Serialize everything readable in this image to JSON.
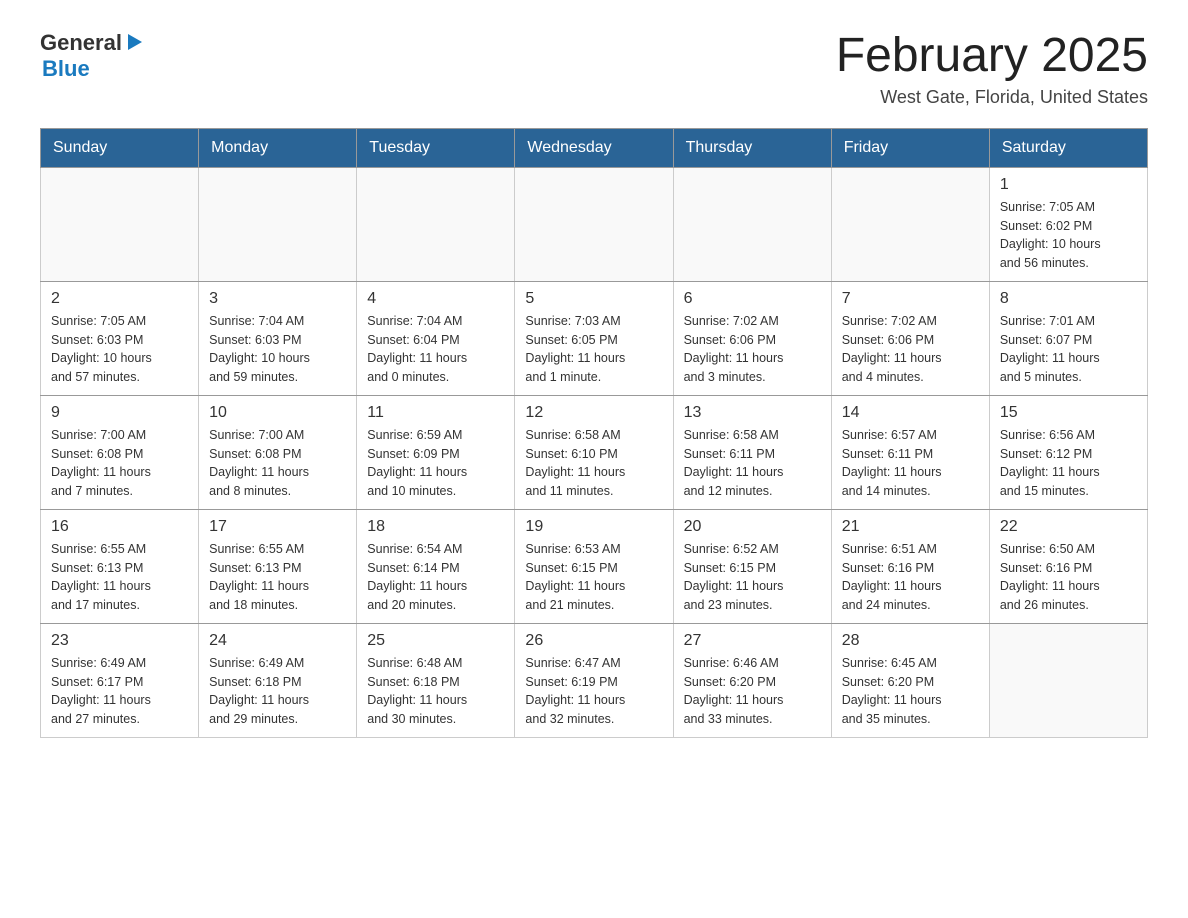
{
  "logo": {
    "general": "General",
    "blue": "Blue",
    "arrow": "▶"
  },
  "title": "February 2025",
  "subtitle": "West Gate, Florida, United States",
  "days_of_week": [
    "Sunday",
    "Monday",
    "Tuesday",
    "Wednesday",
    "Thursday",
    "Friday",
    "Saturday"
  ],
  "weeks": [
    [
      {
        "day": "",
        "info": ""
      },
      {
        "day": "",
        "info": ""
      },
      {
        "day": "",
        "info": ""
      },
      {
        "day": "",
        "info": ""
      },
      {
        "day": "",
        "info": ""
      },
      {
        "day": "",
        "info": ""
      },
      {
        "day": "1",
        "info": "Sunrise: 7:05 AM\nSunset: 6:02 PM\nDaylight: 10 hours\nand 56 minutes."
      }
    ],
    [
      {
        "day": "2",
        "info": "Sunrise: 7:05 AM\nSunset: 6:03 PM\nDaylight: 10 hours\nand 57 minutes."
      },
      {
        "day": "3",
        "info": "Sunrise: 7:04 AM\nSunset: 6:03 PM\nDaylight: 10 hours\nand 59 minutes."
      },
      {
        "day": "4",
        "info": "Sunrise: 7:04 AM\nSunset: 6:04 PM\nDaylight: 11 hours\nand 0 minutes."
      },
      {
        "day": "5",
        "info": "Sunrise: 7:03 AM\nSunset: 6:05 PM\nDaylight: 11 hours\nand 1 minute."
      },
      {
        "day": "6",
        "info": "Sunrise: 7:02 AM\nSunset: 6:06 PM\nDaylight: 11 hours\nand 3 minutes."
      },
      {
        "day": "7",
        "info": "Sunrise: 7:02 AM\nSunset: 6:06 PM\nDaylight: 11 hours\nand 4 minutes."
      },
      {
        "day": "8",
        "info": "Sunrise: 7:01 AM\nSunset: 6:07 PM\nDaylight: 11 hours\nand 5 minutes."
      }
    ],
    [
      {
        "day": "9",
        "info": "Sunrise: 7:00 AM\nSunset: 6:08 PM\nDaylight: 11 hours\nand 7 minutes."
      },
      {
        "day": "10",
        "info": "Sunrise: 7:00 AM\nSunset: 6:08 PM\nDaylight: 11 hours\nand 8 minutes."
      },
      {
        "day": "11",
        "info": "Sunrise: 6:59 AM\nSunset: 6:09 PM\nDaylight: 11 hours\nand 10 minutes."
      },
      {
        "day": "12",
        "info": "Sunrise: 6:58 AM\nSunset: 6:10 PM\nDaylight: 11 hours\nand 11 minutes."
      },
      {
        "day": "13",
        "info": "Sunrise: 6:58 AM\nSunset: 6:11 PM\nDaylight: 11 hours\nand 12 minutes."
      },
      {
        "day": "14",
        "info": "Sunrise: 6:57 AM\nSunset: 6:11 PM\nDaylight: 11 hours\nand 14 minutes."
      },
      {
        "day": "15",
        "info": "Sunrise: 6:56 AM\nSunset: 6:12 PM\nDaylight: 11 hours\nand 15 minutes."
      }
    ],
    [
      {
        "day": "16",
        "info": "Sunrise: 6:55 AM\nSunset: 6:13 PM\nDaylight: 11 hours\nand 17 minutes."
      },
      {
        "day": "17",
        "info": "Sunrise: 6:55 AM\nSunset: 6:13 PM\nDaylight: 11 hours\nand 18 minutes."
      },
      {
        "day": "18",
        "info": "Sunrise: 6:54 AM\nSunset: 6:14 PM\nDaylight: 11 hours\nand 20 minutes."
      },
      {
        "day": "19",
        "info": "Sunrise: 6:53 AM\nSunset: 6:15 PM\nDaylight: 11 hours\nand 21 minutes."
      },
      {
        "day": "20",
        "info": "Sunrise: 6:52 AM\nSunset: 6:15 PM\nDaylight: 11 hours\nand 23 minutes."
      },
      {
        "day": "21",
        "info": "Sunrise: 6:51 AM\nSunset: 6:16 PM\nDaylight: 11 hours\nand 24 minutes."
      },
      {
        "day": "22",
        "info": "Sunrise: 6:50 AM\nSunset: 6:16 PM\nDaylight: 11 hours\nand 26 minutes."
      }
    ],
    [
      {
        "day": "23",
        "info": "Sunrise: 6:49 AM\nSunset: 6:17 PM\nDaylight: 11 hours\nand 27 minutes."
      },
      {
        "day": "24",
        "info": "Sunrise: 6:49 AM\nSunset: 6:18 PM\nDaylight: 11 hours\nand 29 minutes."
      },
      {
        "day": "25",
        "info": "Sunrise: 6:48 AM\nSunset: 6:18 PM\nDaylight: 11 hours\nand 30 minutes."
      },
      {
        "day": "26",
        "info": "Sunrise: 6:47 AM\nSunset: 6:19 PM\nDaylight: 11 hours\nand 32 minutes."
      },
      {
        "day": "27",
        "info": "Sunrise: 6:46 AM\nSunset: 6:20 PM\nDaylight: 11 hours\nand 33 minutes."
      },
      {
        "day": "28",
        "info": "Sunrise: 6:45 AM\nSunset: 6:20 PM\nDaylight: 11 hours\nand 35 minutes."
      },
      {
        "day": "",
        "info": ""
      }
    ]
  ]
}
